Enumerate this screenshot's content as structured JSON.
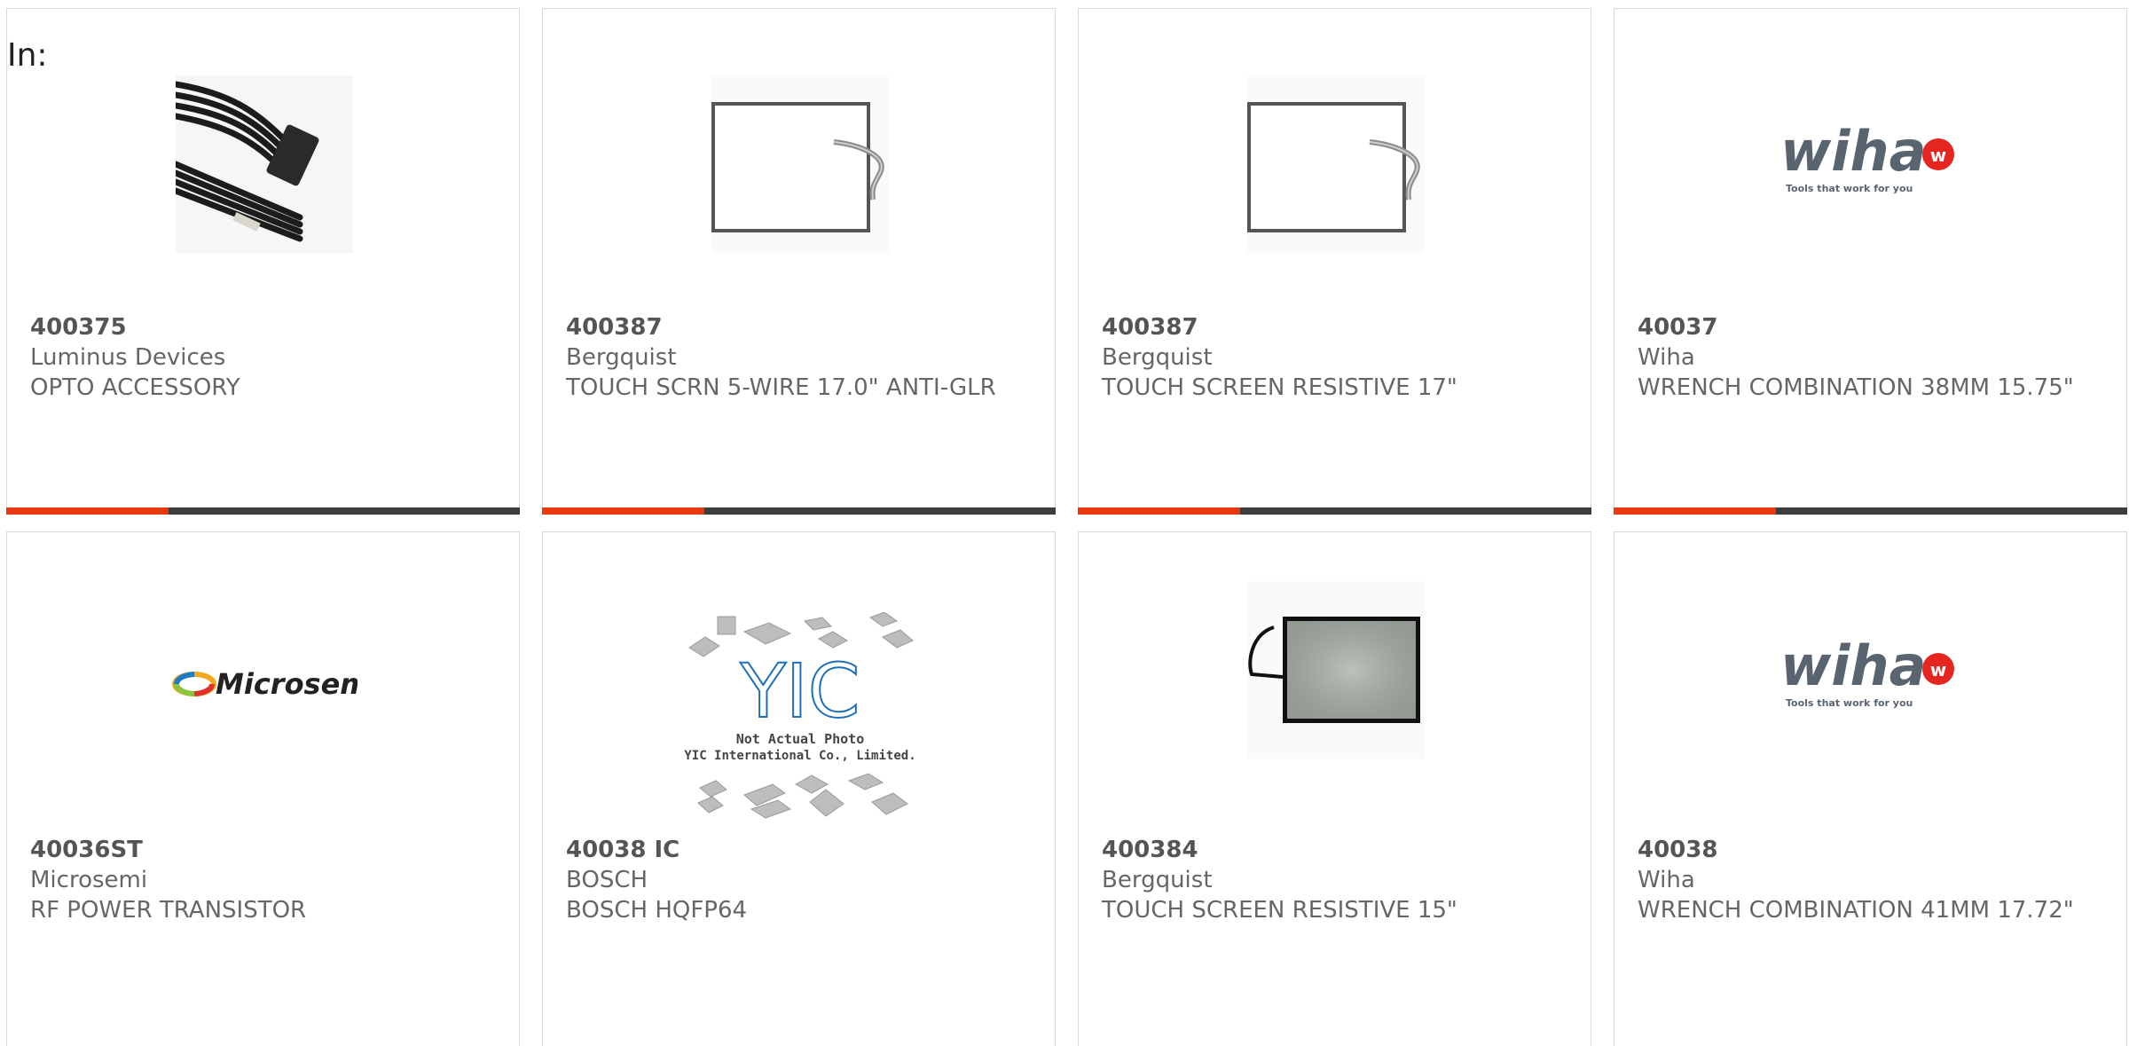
{
  "header": {
    "in_label": "In:"
  },
  "colors": {
    "accent": "#e8390e",
    "bar": "#3d3d3d",
    "text": "#666666"
  },
  "products": [
    {
      "part": "400375",
      "brand": "Luminus Devices",
      "desc": "OPTO ACCESSORY",
      "image": "cable-connector-image"
    },
    {
      "part": "400387",
      "brand": "Bergquist",
      "desc": "TOUCH SCRN 5-WIRE 17.0\" ANTI-GLR",
      "image": "touch-screen-frame-image"
    },
    {
      "part": "400387",
      "brand": "Bergquist",
      "desc": "TOUCH SCREEN RESISTIVE 17\"",
      "image": "touch-screen-frame-image"
    },
    {
      "part": "40037",
      "brand": "Wiha",
      "desc": "WRENCH COMBINATION 38MM 15.75\"",
      "image": "wiha-logo-image"
    },
    {
      "part": "40036ST",
      "brand": "Microsemi",
      "desc": "RF POWER TRANSISTOR",
      "image": "microsemi-logo-image"
    },
    {
      "part": "40038 IC",
      "brand": "BOSCH",
      "desc": "BOSCH HQFP64",
      "image": "yic-not-actual-photo-image"
    },
    {
      "part": "400384",
      "brand": "Bergquist",
      "desc": "TOUCH SCREEN RESISTIVE 15\"",
      "image": "touch-screen-panel-image"
    },
    {
      "part": "40038",
      "brand": "Wiha",
      "desc": "WRENCH COMBINATION 41MM 17.72\"",
      "image": "wiha-logo-image"
    }
  ],
  "logos": {
    "wiha_word": "wiha",
    "wiha_tagline": "Tools that work for you",
    "microsemi_word": "Microsemi",
    "yic_mark": "YIC",
    "yic_line1": "Not Actual Photo",
    "yic_line2": "YIC International Co., Limited."
  }
}
